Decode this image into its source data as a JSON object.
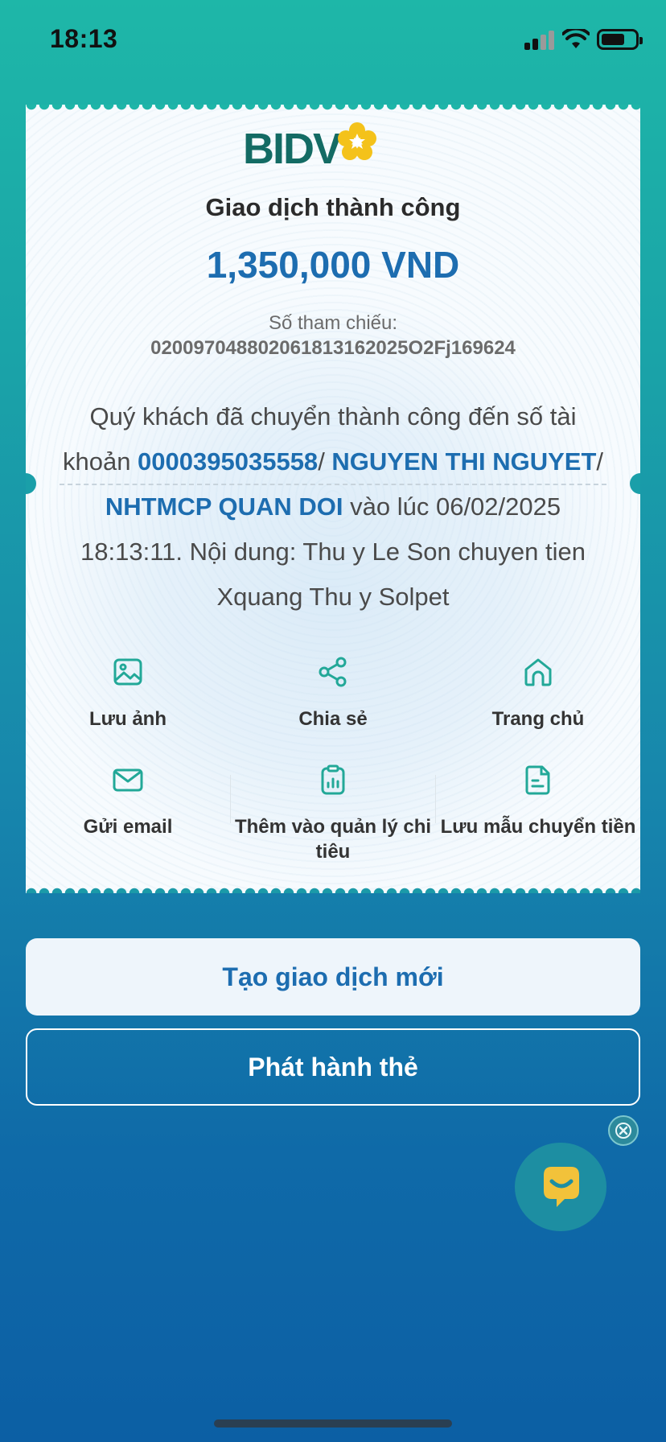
{
  "status_bar": {
    "time": "18:13",
    "signal_icon": "cellular-signal-icon",
    "wifi_icon": "wifi-icon",
    "battery_icon": "battery-icon"
  },
  "receipt": {
    "logo_text": "BIDV",
    "title": "Giao dịch thành công",
    "amount": "1,350,000 VND",
    "reference_label": "Số tham chiếu:",
    "reference_value": "0200970488020618131620250 2Fj169624",
    "message": {
      "part1": "Quý khách đã chuyển thành công đến số tài khoản ",
      "account_number": "0000395035558",
      "sep1": "/ ",
      "account_name": "NGUYEN THI NGUYET",
      "sep2": "/ ",
      "bank_name": "NHTMCP QUAN DOI",
      "part2": " vào lúc 06/02/2025 18:13:11. Nội dung: Thu y Le Son chuyen tien Xquang Thu y Solpet"
    },
    "actions": [
      {
        "label": "Lưu ảnh",
        "icon": "image-icon"
      },
      {
        "label": "Chia sẻ",
        "icon": "share-icon"
      },
      {
        "label": "Trang chủ",
        "icon": "home-icon"
      },
      {
        "label": "Gửi email",
        "icon": "mail-icon"
      },
      {
        "label": "Thêm vào quản lý chi tiêu",
        "icon": "clipboard-chart-icon"
      },
      {
        "label": "Lưu mẫu chuyển tiền",
        "icon": "document-icon"
      }
    ]
  },
  "buttons": {
    "new_transaction": "Tạo giao dịch mới",
    "issue_card": "Phát hành thẻ"
  },
  "colors": {
    "accent_blue": "#1d6db0",
    "brand_green": "#136b64",
    "brand_yellow": "#f4c21a"
  }
}
